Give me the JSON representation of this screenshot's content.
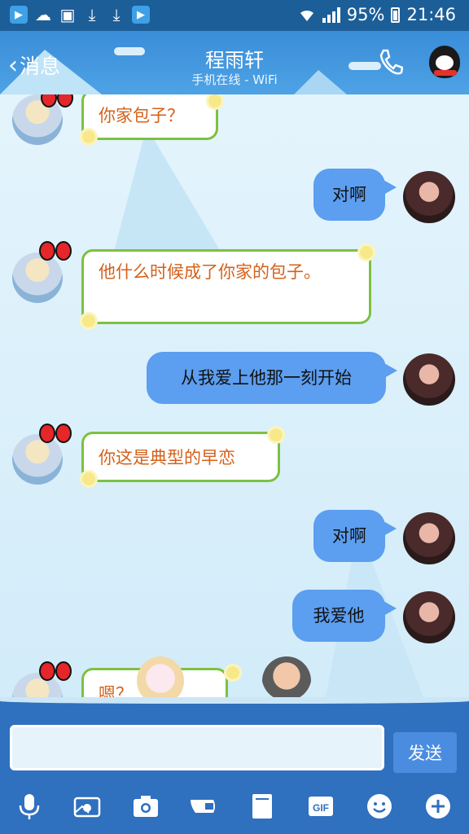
{
  "status_bar": {
    "battery": "95%",
    "time": "21:46",
    "left_icons": [
      "video-app-icon",
      "cloud-icon",
      "image-icon",
      "download-icon",
      "download-icon",
      "video-app-icon"
    ]
  },
  "header": {
    "back_label": "消息",
    "title": "程雨轩",
    "subtitle": "手机在线 - WiFi"
  },
  "messages": [
    {
      "side": "left",
      "text": "你家包子？"
    },
    {
      "side": "right",
      "text": "对啊"
    },
    {
      "side": "left",
      "text": "他什么时候成了你家的包子。"
    },
    {
      "side": "right",
      "text": "从我爱上他那一刻开始"
    },
    {
      "side": "left",
      "text": "你这是典型的早恋"
    },
    {
      "side": "right",
      "text": "对啊"
    },
    {
      "side": "right",
      "text": "我爱他"
    },
    {
      "side": "left",
      "text": "嗯？"
    }
  ],
  "input": {
    "placeholder": "",
    "send_label": "发送"
  },
  "toolbar": {
    "icons": [
      "microphone-icon",
      "photo-album-icon",
      "camera-icon",
      "hongbao-icon",
      "file-icon",
      "gif-icon",
      "emoji-icon",
      "plus-icon"
    ],
    "gif_label": "GIF"
  },
  "colors": {
    "header": "#3a8dd8",
    "bubble_right": "#5c9ef0",
    "bubble_left_border": "#7cc142",
    "bubble_left_text": "#d4611a",
    "input_bar": "#2f70bf"
  }
}
